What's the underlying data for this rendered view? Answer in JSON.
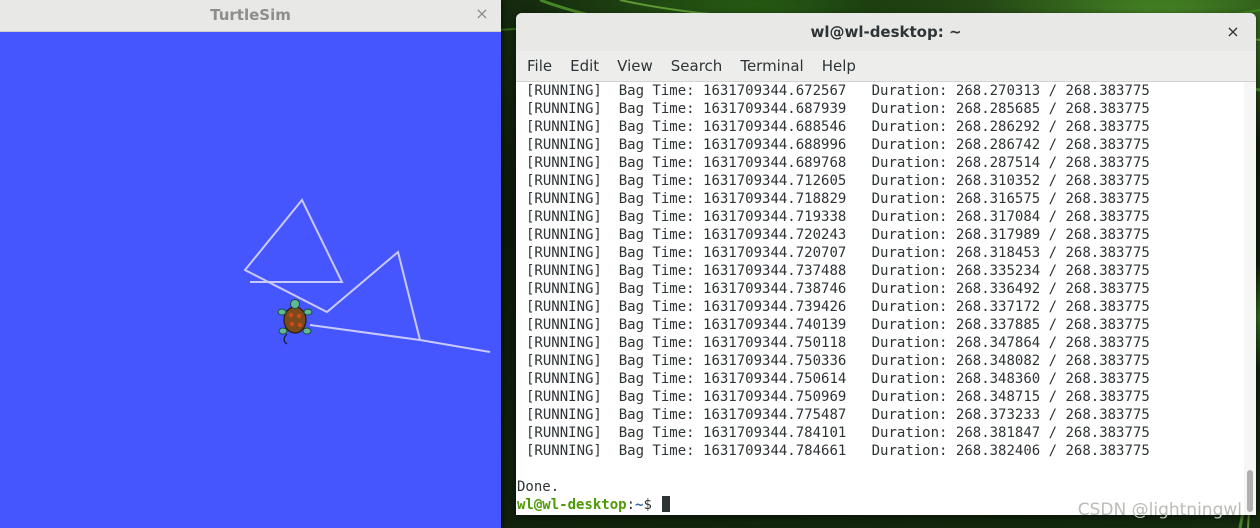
{
  "turtlesim": {
    "title": "TurtleSim",
    "close_glyph": "×",
    "background_color": "#4556ff",
    "pen_color": "#c9c9ff",
    "turtle_icon": "turtle-icon"
  },
  "terminal": {
    "title": "wl@wl-desktop: ~",
    "close_glyph": "×",
    "menu": [
      "File",
      "Edit",
      "View",
      "Search",
      "Terminal",
      "Help"
    ],
    "log_lines": [
      {
        "status": "[RUNNING]",
        "bag_label": "Bag Time:",
        "bag_time": "1631709344.672567",
        "dur_label": "Duration:",
        "duration": "268.270313 / 268.383775"
      },
      {
        "status": "[RUNNING]",
        "bag_label": "Bag Time:",
        "bag_time": "1631709344.687939",
        "dur_label": "Duration:",
        "duration": "268.285685 / 268.383775"
      },
      {
        "status": "[RUNNING]",
        "bag_label": "Bag Time:",
        "bag_time": "1631709344.688546",
        "dur_label": "Duration:",
        "duration": "268.286292 / 268.383775"
      },
      {
        "status": "[RUNNING]",
        "bag_label": "Bag Time:",
        "bag_time": "1631709344.688996",
        "dur_label": "Duration:",
        "duration": "268.286742 / 268.383775"
      },
      {
        "status": "[RUNNING]",
        "bag_label": "Bag Time:",
        "bag_time": "1631709344.689768",
        "dur_label": "Duration:",
        "duration": "268.287514 / 268.383775"
      },
      {
        "status": "[RUNNING]",
        "bag_label": "Bag Time:",
        "bag_time": "1631709344.712605",
        "dur_label": "Duration:",
        "duration": "268.310352 / 268.383775"
      },
      {
        "status": "[RUNNING]",
        "bag_label": "Bag Time:",
        "bag_time": "1631709344.718829",
        "dur_label": "Duration:",
        "duration": "268.316575 / 268.383775"
      },
      {
        "status": "[RUNNING]",
        "bag_label": "Bag Time:",
        "bag_time": "1631709344.719338",
        "dur_label": "Duration:",
        "duration": "268.317084 / 268.383775"
      },
      {
        "status": "[RUNNING]",
        "bag_label": "Bag Time:",
        "bag_time": "1631709344.720243",
        "dur_label": "Duration:",
        "duration": "268.317989 / 268.383775"
      },
      {
        "status": "[RUNNING]",
        "bag_label": "Bag Time:",
        "bag_time": "1631709344.720707",
        "dur_label": "Duration:",
        "duration": "268.318453 / 268.383775"
      },
      {
        "status": "[RUNNING]",
        "bag_label": "Bag Time:",
        "bag_time": "1631709344.737488",
        "dur_label": "Duration:",
        "duration": "268.335234 / 268.383775"
      },
      {
        "status": "[RUNNING]",
        "bag_label": "Bag Time:",
        "bag_time": "1631709344.738746",
        "dur_label": "Duration:",
        "duration": "268.336492 / 268.383775"
      },
      {
        "status": "[RUNNING]",
        "bag_label": "Bag Time:",
        "bag_time": "1631709344.739426",
        "dur_label": "Duration:",
        "duration": "268.337172 / 268.383775"
      },
      {
        "status": "[RUNNING]",
        "bag_label": "Bag Time:",
        "bag_time": "1631709344.740139",
        "dur_label": "Duration:",
        "duration": "268.337885 / 268.383775"
      },
      {
        "status": "[RUNNING]",
        "bag_label": "Bag Time:",
        "bag_time": "1631709344.750118",
        "dur_label": "Duration:",
        "duration": "268.347864 / 268.383775"
      },
      {
        "status": "[RUNNING]",
        "bag_label": "Bag Time:",
        "bag_time": "1631709344.750336",
        "dur_label": "Duration:",
        "duration": "268.348082 / 268.383775"
      },
      {
        "status": "[RUNNING]",
        "bag_label": "Bag Time:",
        "bag_time": "1631709344.750614",
        "dur_label": "Duration:",
        "duration": "268.348360 / 268.383775"
      },
      {
        "status": "[RUNNING]",
        "bag_label": "Bag Time:",
        "bag_time": "1631709344.750969",
        "dur_label": "Duration:",
        "duration": "268.348715 / 268.383775"
      },
      {
        "status": "[RUNNING]",
        "bag_label": "Bag Time:",
        "bag_time": "1631709344.775487",
        "dur_label": "Duration:",
        "duration": "268.373233 / 268.383775"
      },
      {
        "status": "[RUNNING]",
        "bag_label": "Bag Time:",
        "bag_time": "1631709344.784101",
        "dur_label": "Duration:",
        "duration": "268.381847 / 268.383775"
      },
      {
        "status": "[RUNNING]",
        "bag_label": "Bag Time:",
        "bag_time": "1631709344.784661",
        "dur_label": "Duration:",
        "duration": "268.382406 / 268.383775"
      }
    ],
    "done_text": "Done.",
    "prompt": {
      "user_host": "wl@wl-desktop",
      "separator": ":",
      "path": "~",
      "symbol": "$ "
    },
    "colors": {
      "prompt_user": "#4e9a06",
      "prompt_path": "#3465a4",
      "text": "#2e3436"
    }
  },
  "watermark": "CSDN @lightningwl"
}
